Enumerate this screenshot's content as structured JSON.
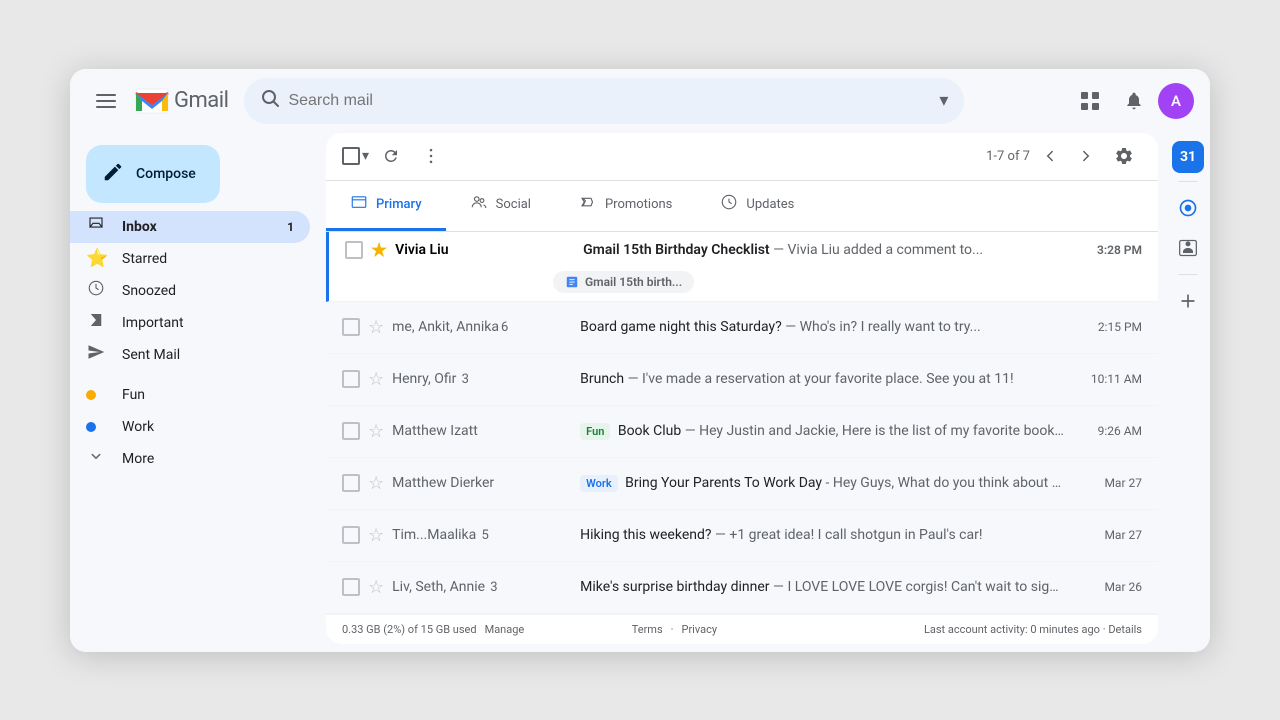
{
  "app": {
    "title": "Gmail",
    "logo_text": "Gmail"
  },
  "header": {
    "search_placeholder": "Search mail",
    "apps_icon": "⊞",
    "notification_icon": "🔔",
    "avatar_initial": "A"
  },
  "compose": {
    "label": "Compose",
    "icon": "✏"
  },
  "sidebar": {
    "items": [
      {
        "id": "inbox",
        "label": "Inbox",
        "icon": "inbox",
        "badge": "1",
        "active": true
      },
      {
        "id": "starred",
        "label": "Starred",
        "icon": "star",
        "badge": "",
        "active": false
      },
      {
        "id": "snoozed",
        "label": "Snoozed",
        "icon": "clock",
        "badge": "",
        "active": false
      },
      {
        "id": "important",
        "label": "Important",
        "icon": "label",
        "badge": "",
        "active": false
      },
      {
        "id": "sent",
        "label": "Sent Mail",
        "icon": "send",
        "badge": "",
        "active": false
      },
      {
        "id": "fun",
        "label": "Fun",
        "icon": "dot-yellow",
        "badge": "",
        "active": false
      },
      {
        "id": "work",
        "label": "Work",
        "icon": "dot-blue",
        "badge": "",
        "active": false
      },
      {
        "id": "more",
        "label": "More",
        "icon": "chevron-down",
        "badge": "",
        "active": false
      }
    ]
  },
  "toolbar": {
    "pagination_text": "1-7 of 7",
    "more_options_label": "⋮"
  },
  "tabs": [
    {
      "id": "primary",
      "label": "Primary",
      "icon": "inbox-tab",
      "active": true
    },
    {
      "id": "social",
      "label": "Social",
      "icon": "people-tab",
      "active": false
    },
    {
      "id": "promotions",
      "label": "Promotions",
      "icon": "tag-tab",
      "active": false
    },
    {
      "id": "updates",
      "label": "Updates",
      "icon": "info-tab",
      "active": false
    }
  ],
  "emails": [
    {
      "id": 1,
      "sender": "Vivia Liu",
      "starred": true,
      "subject": "Gmail 15th Birthday Checklist",
      "preview": "— Vivia Liu added a comment to...",
      "attachment": "Gmail 15th birth...",
      "time": "3:28 PM",
      "unread": true,
      "tag": ""
    },
    {
      "id": 2,
      "sender": "me, Ankit, Annika",
      "sender_count": "6",
      "starred": false,
      "subject": "Board game night this Saturday?",
      "preview": "— Who's in? I really want to try...",
      "time": "2:15 PM",
      "unread": false,
      "tag": ""
    },
    {
      "id": 3,
      "sender": "Henry, Ofir",
      "sender_count": "3",
      "starred": false,
      "subject": "Brunch",
      "preview": "— I've made a reservation at your favorite place. See you at 11!",
      "time": "10:11 AM",
      "unread": false,
      "tag": ""
    },
    {
      "id": 4,
      "sender": "Matthew Izatt",
      "sender_count": "",
      "starred": false,
      "subject": "Book Club",
      "preview": "— Hey Justin and Jackie, Here is the list of my favorite books: The...",
      "time": "9:26 AM",
      "unread": false,
      "tag": "Fun"
    },
    {
      "id": 5,
      "sender": "Matthew Dierker",
      "sender_count": "",
      "starred": false,
      "subject": "Bring Your Parents To Work Day",
      "preview": "- Hey Guys, What do you think about a...",
      "time": "Mar 27",
      "unread": false,
      "tag": "Work"
    },
    {
      "id": 6,
      "sender": "Tim...Maalika",
      "sender_count": "5",
      "starred": false,
      "subject": "Hiking this weekend?",
      "preview": "— +1 great idea! I call shotgun in Paul's car!",
      "time": "Mar 27",
      "unread": false,
      "tag": ""
    },
    {
      "id": 7,
      "sender": "Liv, Seth, Annie",
      "sender_count": "3",
      "starred": false,
      "subject": "Mike's surprise birthday dinner",
      "preview": "— I LOVE LOVE LOVE corgis! Can't wait to sign that card.",
      "time": "Mar 26",
      "unread": false,
      "tag": ""
    }
  ],
  "footer": {
    "storage": "0.33 GB (2%) of 15 GB used",
    "manage": "Manage",
    "terms": "Terms",
    "privacy": "Privacy",
    "last_activity": "Last account activity: 0 minutes ago",
    "details": "Details"
  }
}
